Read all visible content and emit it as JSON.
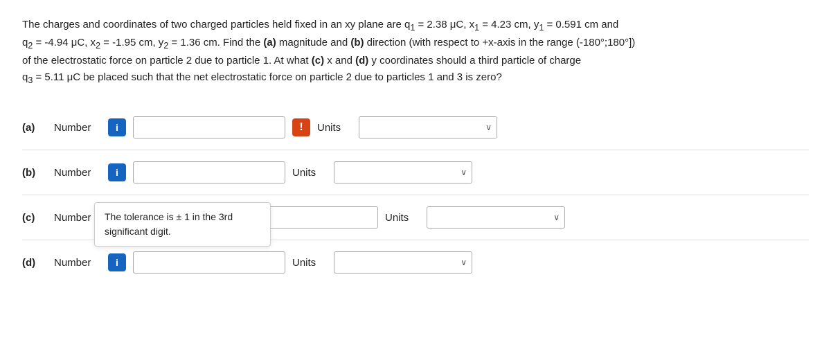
{
  "problem": {
    "text_line1": "The charges and coordinates of two charged particles held fixed in an xy plane are q",
    "sub1": "1",
    "eq1": " = 2.38 μC, x",
    "sub2": "1",
    "eq2": " = 4.23 cm, y",
    "sub3": "1",
    "eq3": " = 0.591 cm and",
    "text_line2": "q",
    "sub4": "2",
    "eq4": " = -4.94 μC, x",
    "sub5": "2",
    "eq5": " = -1.95 cm, y",
    "sub6": "2",
    "eq6": " = 1.36 cm. Find the (a) magnitude and (b) direction (with respect to +x-axis in the range (-180°;180°])",
    "text_line3": "of the electrostatic force on particle 2 due to particle 1. At what (c) x and (d) y coordinates should a third particle of charge",
    "text_line4": "q",
    "sub7": "3",
    "eq7": " = 5.11 μC be placed such that the net electrostatic force on particle 2 due to particles 1 and 3 is zero?"
  },
  "rows": {
    "a": {
      "label": "(a)",
      "sublabel": "Number",
      "info_label": "i",
      "alert_label": "!",
      "units_label": "Units",
      "number_placeholder": "",
      "units_placeholder": ""
    },
    "b": {
      "label": "(b)",
      "sublabel": "Number",
      "info_label": "i",
      "units_label": "Units",
      "number_placeholder": "",
      "units_placeholder": ""
    },
    "c": {
      "label": "(c)",
      "sublabel": "Number",
      "info_label": "",
      "units_label": "Units",
      "number_placeholder": "",
      "units_placeholder": "",
      "tolerance_line1": "The tolerance is ± 1 in the 3rd",
      "tolerance_line2": "significant digit."
    },
    "d": {
      "label": "(d)",
      "sublabel": "Number",
      "info_label": "i",
      "units_label": "Units",
      "number_placeholder": "",
      "units_placeholder": ""
    }
  },
  "icons": {
    "chevron": "∨",
    "alert": "!",
    "info": "i"
  }
}
